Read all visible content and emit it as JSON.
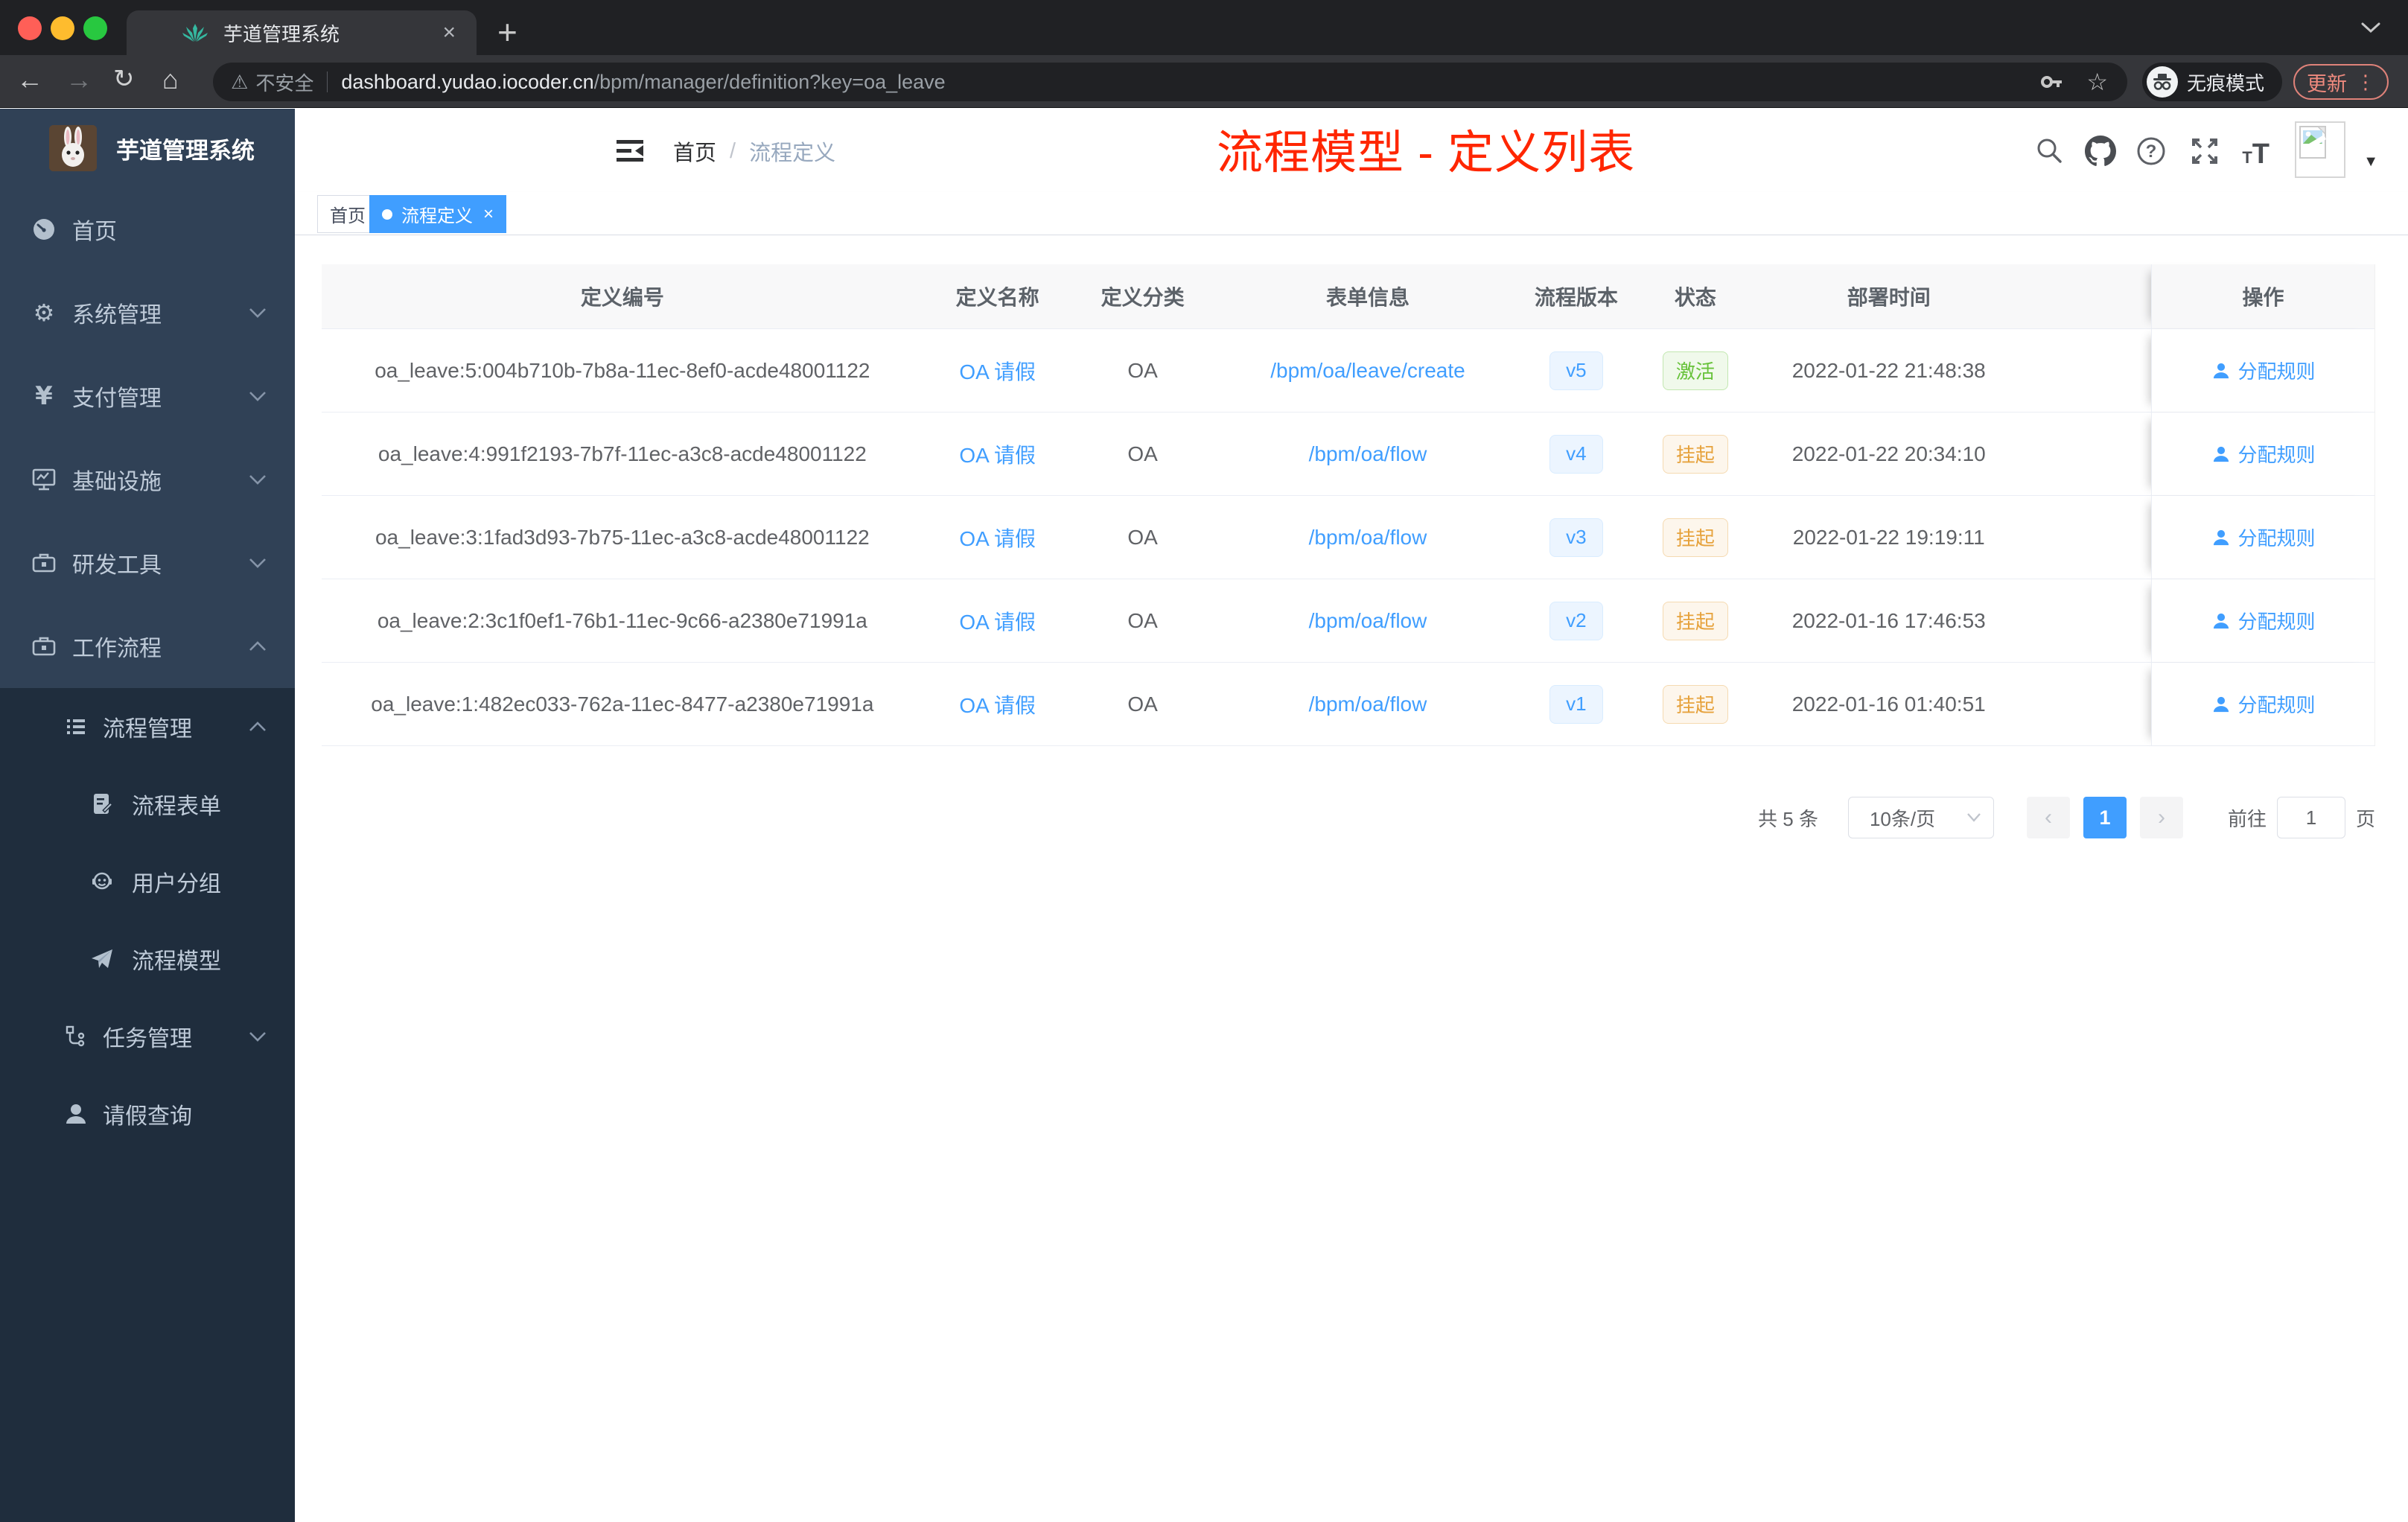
{
  "browser": {
    "tab_title": "芋道管理系统",
    "new_tab": "+",
    "close_tab": "×",
    "back": "←",
    "forward": "→",
    "reload": "↻",
    "home": "⌂",
    "warning": "⚠",
    "security_label": "不安全",
    "url_host": "dashboard.yudao.iocoder.cn",
    "url_path": "/bpm/manager/definition?key=oa_leave",
    "star": "☆",
    "incognito_label": "无痕模式",
    "update_label": "更新",
    "menu_dots": "⋮",
    "traffic_colors": {
      "close": "#ff5f57",
      "min": "#febc2e",
      "max": "#28c840"
    }
  },
  "sidebar": {
    "logo_title": "芋道管理系统",
    "items": [
      {
        "label": "首页"
      },
      {
        "label": "系统管理"
      },
      {
        "label": "支付管理"
      },
      {
        "label": "基础设施"
      },
      {
        "label": "研发工具"
      },
      {
        "label": "工作流程"
      },
      {
        "label": "流程管理"
      },
      {
        "label": "流程表单"
      },
      {
        "label": "用户分组"
      },
      {
        "label": "流程模型"
      },
      {
        "label": "任务管理"
      },
      {
        "label": "请假查询"
      }
    ],
    "gear_glyph": "⚙",
    "yen_glyph": "¥"
  },
  "navbar": {
    "breadcrumb": {
      "home": "首页",
      "separator": "/",
      "current": "流程定义"
    },
    "font_icon_small": "T",
    "font_icon_big": "T",
    "caret": "▼"
  },
  "tags": {
    "home": "首页",
    "active": "流程定义",
    "close": "×"
  },
  "annotation": "流程模型 - 定义列表",
  "accent_colors": {
    "primary": "#409eff",
    "success": "#67c23a",
    "warning": "#e6a23c",
    "annotation": "#ff2600"
  },
  "table": {
    "columns": [
      "定义编号",
      "定义名称",
      "定义分类",
      "表单信息",
      "流程版本",
      "状态",
      "部署时间",
      "操作"
    ],
    "rows": [
      {
        "id": "oa_leave:5:004b710b-7b8a-11ec-8ef0-acde48001122",
        "name": "OA 请假",
        "category": "OA",
        "form": "/bpm/oa/leave/create",
        "version": "v5",
        "status": "激活",
        "status_type": "success",
        "deployed": "2022-01-22 21:48:38",
        "action": "分配规则"
      },
      {
        "id": "oa_leave:4:991f2193-7b7f-11ec-a3c8-acde48001122",
        "name": "OA 请假",
        "category": "OA",
        "form": "/bpm/oa/flow",
        "version": "v4",
        "status": "挂起",
        "status_type": "warning",
        "deployed": "2022-01-22 20:34:10",
        "action": "分配规则"
      },
      {
        "id": "oa_leave:3:1fad3d93-7b75-11ec-a3c8-acde48001122",
        "name": "OA 请假",
        "category": "OA",
        "form": "/bpm/oa/flow",
        "version": "v3",
        "status": "挂起",
        "status_type": "warning",
        "deployed": "2022-01-22 19:19:11",
        "action": "分配规则"
      },
      {
        "id": "oa_leave:2:3c1f0ef1-76b1-11ec-9c66-a2380e71991a",
        "name": "OA 请假",
        "category": "OA",
        "form": "/bpm/oa/flow",
        "version": "v2",
        "status": "挂起",
        "status_type": "warning",
        "deployed": "2022-01-16 17:46:53",
        "action": "分配规则"
      },
      {
        "id": "oa_leave:1:482ec033-762a-11ec-8477-a2380e71991a",
        "name": "OA 请假",
        "category": "OA",
        "form": "/bpm/oa/flow",
        "version": "v1",
        "status": "挂起",
        "status_type": "warning",
        "deployed": "2022-01-16 01:40:51",
        "action": "分配规则"
      }
    ]
  },
  "pagination": {
    "total": "共 5 条",
    "page_size": "10条/页",
    "prev": "‹",
    "current": "1",
    "next": "›",
    "goto_label": "前往",
    "goto_value": "1",
    "unit": "页"
  }
}
